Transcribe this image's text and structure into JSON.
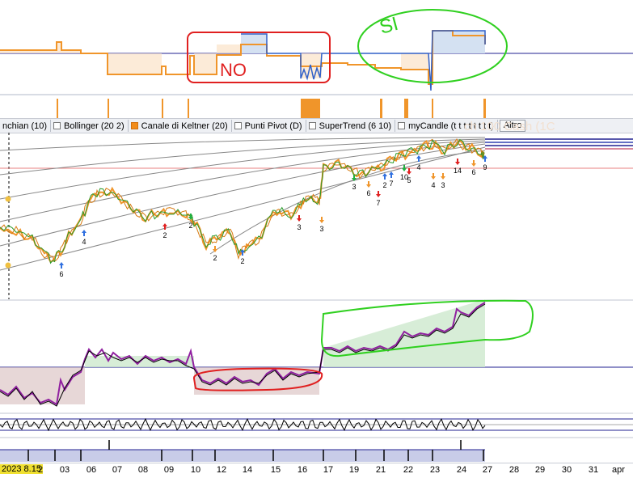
{
  "toolbar": {
    "items": [
      {
        "label": "nchian (10)",
        "checked": false
      },
      {
        "label": "Bollinger (20 2)",
        "checked": false
      },
      {
        "label": "Canale di Keltner (20)",
        "checked": true
      },
      {
        "label": "Punti Pivot (D)",
        "checked": false
      },
      {
        "label": "SuperTrend (6 10)",
        "checked": false
      },
      {
        "label": "myCandle (t t t t t t t t)",
        "checked": false
      }
    ],
    "more_label": "Altro"
  },
  "watermark": "ch 100 Cash (1C",
  "annotations": {
    "no_text": "NO",
    "si_text": "SI"
  },
  "colors": {
    "orange": "#f0952a",
    "blue": "#3060c8",
    "navy": "#202090",
    "red_line": "#e04040",
    "purple": "#9020a0",
    "red_marker": "#e02020",
    "green_marker": "#20b040",
    "annotation_red": "#e02020",
    "annotation_green": "#30d020"
  },
  "signal_numbers": [
    "6",
    "4",
    "2",
    "2",
    "2",
    "2",
    "3",
    "3",
    "3",
    "6",
    "7",
    "2",
    "7",
    "10",
    "5",
    "4",
    "4",
    "3",
    "14",
    "6",
    "9"
  ],
  "xaxis": {
    "first_label": "2023 8.15",
    "ticks": [
      "2",
      "03",
      "06",
      "07",
      "08",
      "09",
      "10",
      "11",
      "12",
      "13",
      "14",
      "15",
      "16",
      "17",
      "18",
      "19",
      "20",
      "21",
      "22",
      "23",
      "24",
      "27",
      "28",
      "29",
      "30",
      "31",
      "apr"
    ]
  }
}
